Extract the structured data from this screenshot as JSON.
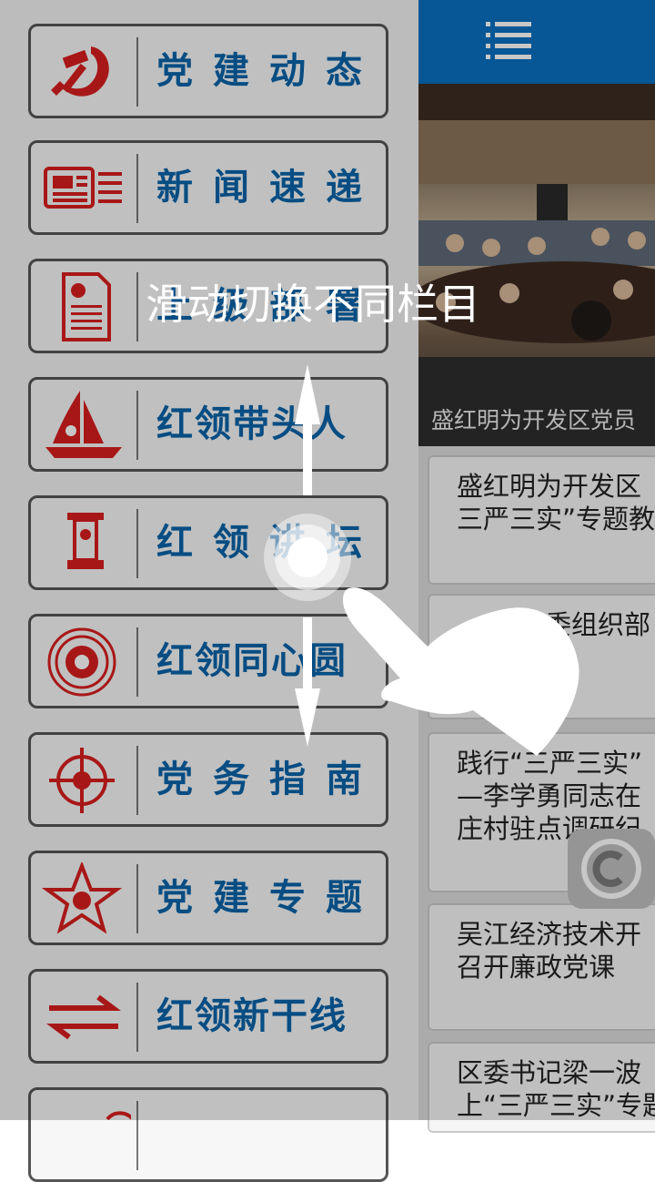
{
  "drawer": {
    "items": [
      {
        "label": "党建动态",
        "icon": "hammer-sickle-icon"
      },
      {
        "label": "新闻速递",
        "icon": "newspaper-icon"
      },
      {
        "label": "上级部署",
        "icon": "document-icon"
      },
      {
        "label": "红领带头人",
        "icon": "sailboat-icon"
      },
      {
        "label": "红领讲坛",
        "icon": "podium-icon"
      },
      {
        "label": "红领同心圆",
        "icon": "concentric-circle-icon"
      },
      {
        "label": "党务指南",
        "icon": "crosshair-icon"
      },
      {
        "label": "党建专题",
        "icon": "star-icon"
      },
      {
        "label": "红领新干线",
        "icon": "exchange-arrows-icon"
      }
    ]
  },
  "content": {
    "banner_caption": "盛红明为开发区党员",
    "news": [
      {
        "title": "盛红明为开发区\n三严三实”专题教"
      },
      {
        "title": "区委组织部\n动"
      },
      {
        "title": "践行“三严三实”\n—李学勇同志在\n庄村驻点调研纪"
      },
      {
        "title": "吴江经济技术开\n召开廉政党课"
      },
      {
        "title": "区委书记梁一波\n上“三严三实”专题"
      }
    ]
  },
  "guide": {
    "hint": "滑动切换不同栏目"
  },
  "colors": {
    "party_red": "#d81e1e",
    "label_blue": "#0a63a8",
    "topbar": "#0a6fbf"
  }
}
